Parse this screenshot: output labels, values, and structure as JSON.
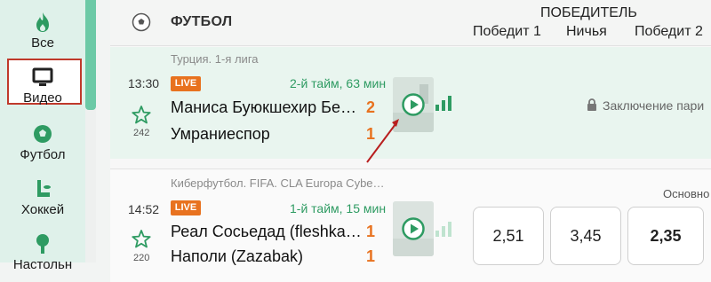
{
  "sidebar": {
    "items": [
      {
        "label": "Все",
        "icon": "fire-icon"
      },
      {
        "label": "Видео",
        "icon": "monitor-icon"
      },
      {
        "label": "Футбол",
        "icon": "soccer-ball-icon"
      },
      {
        "label": "Хоккей",
        "icon": "hockey-icon"
      },
      {
        "label": "Настольн",
        "icon": "table-tennis-icon"
      }
    ],
    "active_index": 1
  },
  "header": {
    "sport": "ФУТБОЛ",
    "winner": "ПОБЕДИТЕЛЬ",
    "col1": "Победит 1",
    "col2": "Ничья",
    "col3": "Победит 2"
  },
  "matches": [
    {
      "league": "Турция. 1-я лига",
      "time": "13:30",
      "live": "LIVE",
      "period": "2-й тайм, 63 мин",
      "team1": "Маниса Буюкшехир Бе…",
      "team2": "Умраниеспор",
      "score1": "2",
      "score2": "1",
      "fav_count": "242",
      "status": "Заключение пари"
    },
    {
      "league": "Киберфутбол. FIFA. CLA Europa Cybe…",
      "time": "14:52",
      "live": "LIVE",
      "period": "1-й тайм, 15 мин",
      "team1": "Реал Сосьедад (fleshka…",
      "team2": "Наполи (Zazabak)",
      "score1": "1",
      "score2": "1",
      "fav_count": "220",
      "market": "Основно",
      "odds": [
        "2,51",
        "3,45",
        "2,35"
      ]
    }
  ],
  "colors": {
    "accent": "#2e9b62",
    "live": "#e8721f",
    "sidebar_bg": "#dff1ea",
    "highlight": "#c0392b"
  }
}
